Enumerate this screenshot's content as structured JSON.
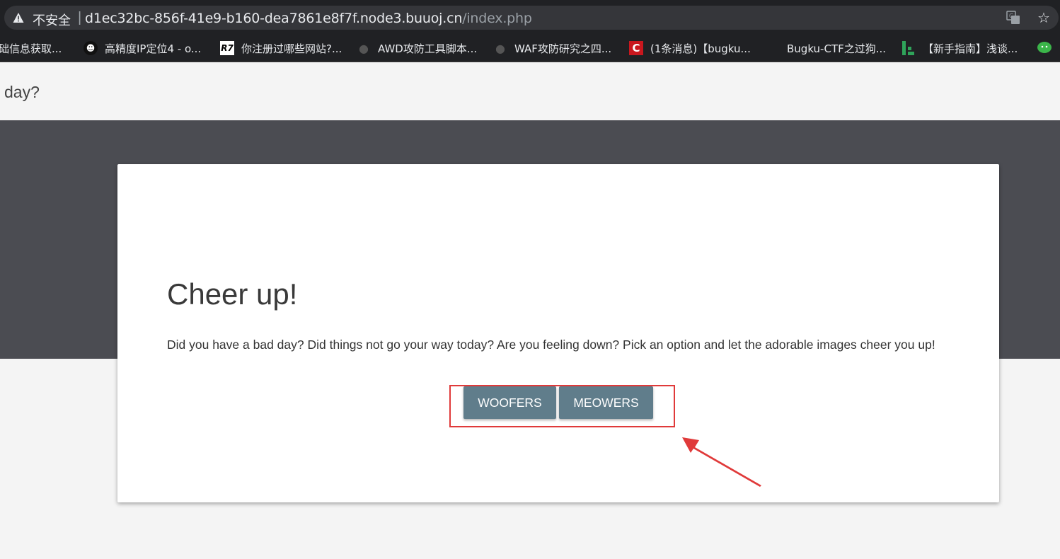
{
  "browser": {
    "insecure_label": "不安全",
    "separator": "|",
    "url_host": "d1ec32bc-856f-41e9-b160-dea7861e8f7f.node3.buuoj.cn",
    "url_path": "/index.php",
    "bookmarks": [
      {
        "label": "础信息获取...",
        "icon": "none"
      },
      {
        "label": "高精度IP定位4 - o...",
        "icon": "avatar-icon"
      },
      {
        "label": "你注册过哪些网站?...",
        "icon": "r7-icon"
      },
      {
        "label": "AWD攻防工具脚本...",
        "icon": "github-icon"
      },
      {
        "label": "WAF攻防研究之四...",
        "icon": "github-icon"
      },
      {
        "label": "(1条消息)【bugku...",
        "icon": "csdn-icon"
      },
      {
        "label": "Bugku-CTF之过狗...",
        "icon": "none"
      },
      {
        "label": "【新手指南】浅谈...",
        "icon": "bar-icon"
      }
    ]
  },
  "page": {
    "header_text": "day?",
    "card": {
      "title": "Cheer up!",
      "text": "Did you have a bad day? Did things not go your way today? Are you feeling down? Pick an option and let the adorable images cheer you up!",
      "button_woofers": "WOOFERS",
      "button_meowers": "MEOWERS"
    }
  },
  "colors": {
    "button_bg": "#607d8b",
    "dark_band": "#4b4c52",
    "annotation_red": "#e03a3a"
  }
}
